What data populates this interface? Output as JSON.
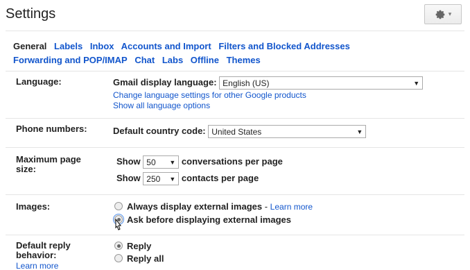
{
  "header": {
    "title": "Settings",
    "gear_icon": "gear-icon",
    "gear_caret": "▾"
  },
  "tabs": [
    {
      "label": "General",
      "active": true
    },
    {
      "label": "Labels"
    },
    {
      "label": "Inbox"
    },
    {
      "label": "Accounts and Import"
    },
    {
      "label": "Filters and Blocked Addresses"
    },
    {
      "label": "Forwarding and POP/IMAP"
    },
    {
      "label": "Chat"
    },
    {
      "label": "Labs"
    },
    {
      "label": "Offline"
    },
    {
      "label": "Themes"
    }
  ],
  "language": {
    "label": "Language:",
    "display_label": "Gmail display language:",
    "display_value": "English (US)",
    "change_link": "Change language settings for other Google products",
    "show_all_link": "Show all language options"
  },
  "phone": {
    "label": "Phone numbers:",
    "country_label": "Default country code:",
    "country_value": "United States"
  },
  "page_size": {
    "label": "Maximum page size:",
    "show": "Show",
    "conversations_value": "50",
    "conversations_suffix": "conversations per page",
    "contacts_value": "250",
    "contacts_suffix": "contacts per page"
  },
  "images": {
    "label": "Images:",
    "option1": "Always display external images",
    "option1_sep": " - ",
    "learn_more": "Learn more",
    "option2": "Ask before displaying external images"
  },
  "reply": {
    "label": "Default reply behavior:",
    "learn_more": "Learn more",
    "option1": "Reply",
    "option2": "Reply all"
  },
  "colors": {
    "link": "#1155cc",
    "border": "#e5e5e5"
  }
}
